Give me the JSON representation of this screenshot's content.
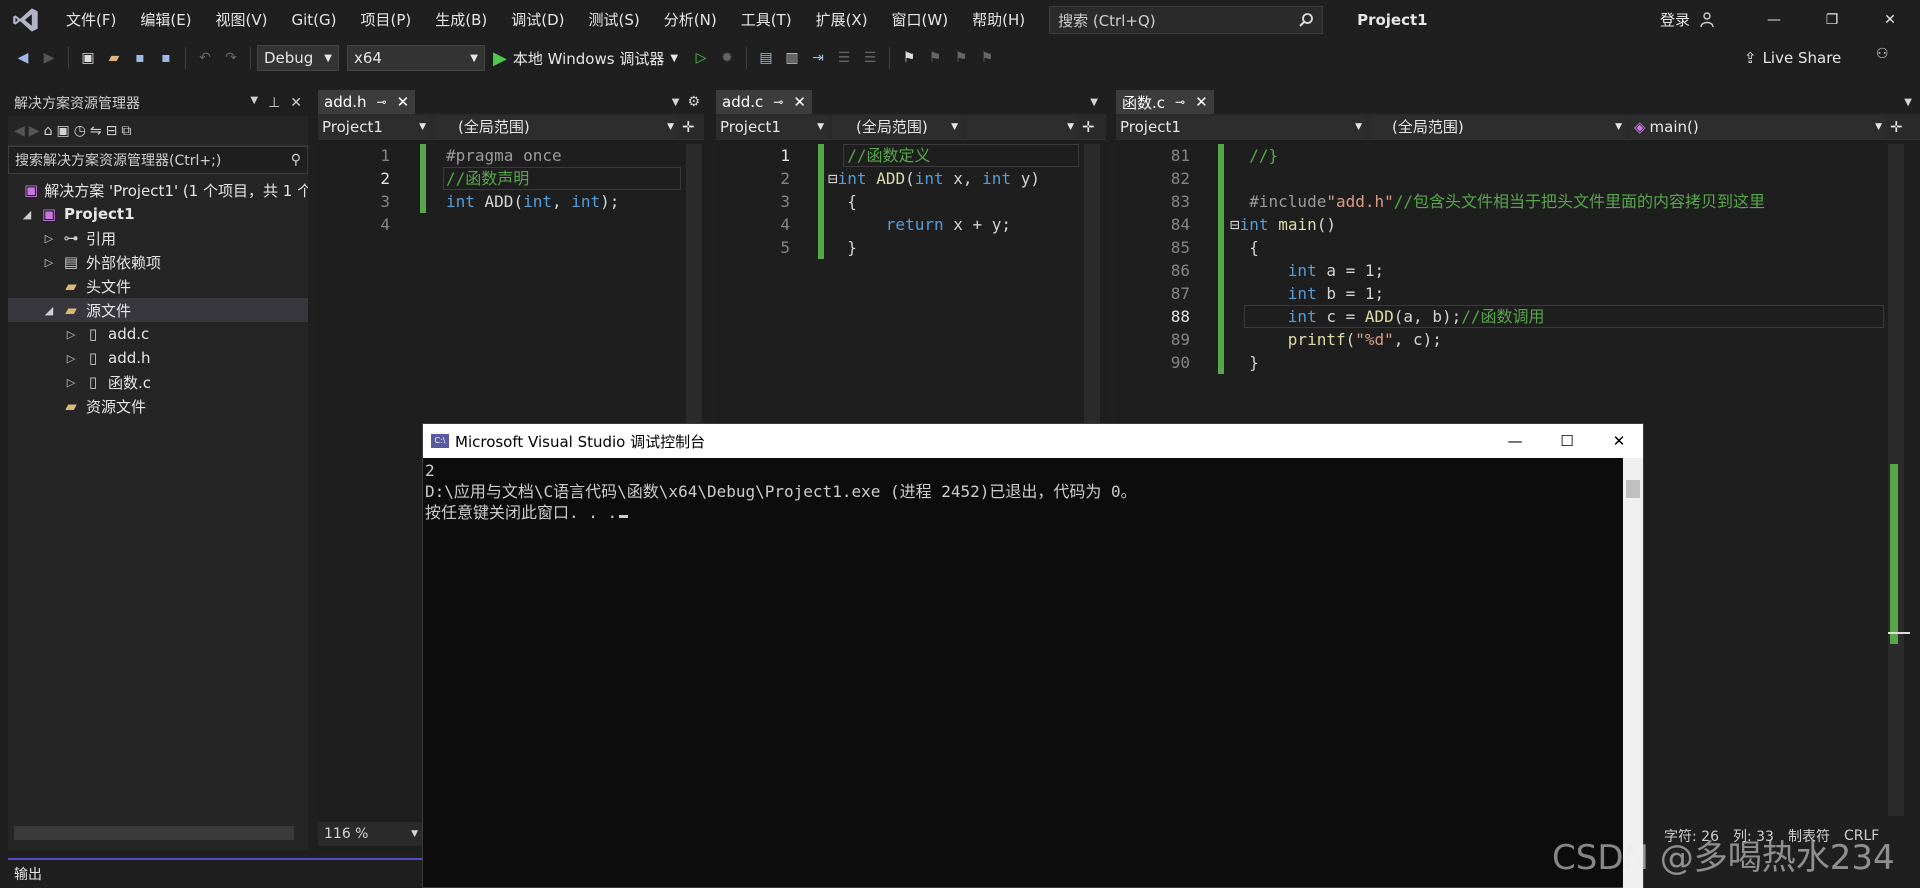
{
  "menu": {
    "items": [
      "文件(F)",
      "编辑(E)",
      "视图(V)",
      "Git(G)",
      "项目(P)",
      "生成(B)",
      "调试(D)",
      "测试(S)",
      "分析(N)",
      "工具(T)",
      "扩展(X)",
      "窗口(W)",
      "帮助(H)"
    ],
    "search_placeholder": "搜索 (Ctrl+Q)",
    "project_title": "Project1",
    "login": "登录"
  },
  "toolbar": {
    "config": "Debug",
    "platform": "x64",
    "run_label": "本地 Windows 调试器",
    "live_share": "Live Share"
  },
  "solution_explorer": {
    "title": "解决方案资源管理器",
    "search_placeholder": "搜索解决方案资源管理器(Ctrl+;)",
    "solution_label": "解决方案 'Project1' (1 个项目，共 1 个",
    "project": "Project1",
    "nodes": {
      "references": "引用",
      "external": "外部依赖项",
      "headers": "头文件",
      "sources": "源文件",
      "add_c": "add.c",
      "add_h": "add.h",
      "func_c": "函数.c",
      "resources": "资源文件"
    }
  },
  "editors": {
    "pane1": {
      "tab": "add.h",
      "project": "Project1",
      "scope": "(全局范围)",
      "lines": [
        "1",
        "2",
        "3",
        "4"
      ],
      "zoom": "116 %"
    },
    "pane2": {
      "tab": "add.c",
      "project": "Project1",
      "scope": "(全局范围)",
      "lines": [
        "1",
        "2",
        "3",
        "4",
        "5"
      ]
    },
    "pane3": {
      "tab": "函数.c",
      "project": "Project1",
      "scope": "(全局范围)",
      "member": "main()",
      "lines": [
        "81",
        "82",
        "83",
        "84",
        "85",
        "86",
        "87",
        "88",
        "89",
        "90"
      ]
    }
  },
  "console": {
    "title": "Microsoft Visual Studio 调试控制台",
    "line1": "2",
    "line2": "D:\\应用与文档\\C语言代码\\函数\\x64\\Debug\\Project1.exe (进程 2452)已退出，代码为 0。",
    "line3": "按任意键关闭此窗口. . ."
  },
  "status": {
    "char": "字符: 26",
    "col": "列: 33",
    "tabs": "制表符",
    "eol": "CRLF"
  },
  "output_panel": {
    "label": "输出"
  },
  "watermark": "CSDN @多喝热水234"
}
